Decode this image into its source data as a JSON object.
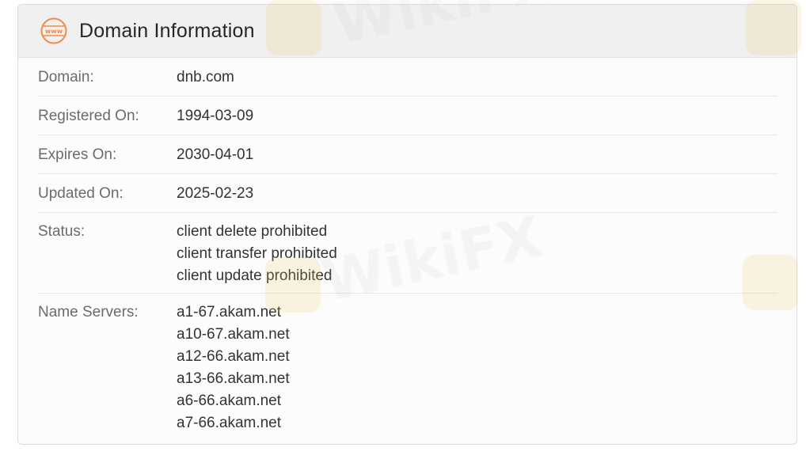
{
  "card": {
    "title": "Domain Information",
    "icon": "www-globe-icon",
    "accent_color": "#f08a4b"
  },
  "rows": {
    "domain": {
      "label": "Domain:",
      "values": [
        "dnb.com"
      ]
    },
    "registered": {
      "label": "Registered On:",
      "values": [
        "1994-03-09"
      ]
    },
    "expires": {
      "label": "Expires On:",
      "values": [
        "2030-04-01"
      ]
    },
    "updated": {
      "label": "Updated On:",
      "values": [
        "2025-02-23"
      ]
    },
    "status": {
      "label": "Status:",
      "values": [
        "client delete prohibited",
        "client transfer prohibited",
        "client update prohibited"
      ]
    },
    "name_servers": {
      "label": "Name Servers:",
      "values": [
        "a1-67.akam.net",
        "a10-67.akam.net",
        "a12-66.akam.net",
        "a13-66.akam.net",
        "a6-66.akam.net",
        "a7-66.akam.net"
      ]
    }
  },
  "watermark": {
    "text": "WikiFX",
    "logo_color": "#f1c66a"
  }
}
